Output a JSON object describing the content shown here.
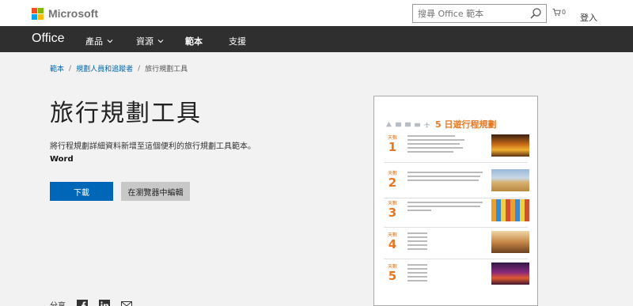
{
  "header": {
    "brand": "Microsoft",
    "search_placeholder": "搜尋 Office 範本",
    "cart_count": "0",
    "signin": "登入"
  },
  "nav": {
    "brand": "Office",
    "items": [
      {
        "label": "產品",
        "has_dropdown": true
      },
      {
        "label": "資源",
        "has_dropdown": true
      },
      {
        "label": "範本",
        "has_dropdown": false,
        "active": true
      },
      {
        "label": "支援",
        "has_dropdown": false
      }
    ]
  },
  "breadcrumb": {
    "items": [
      "範本",
      "規劃人員和追蹤者"
    ],
    "current": "旅行規劃工具"
  },
  "main": {
    "title": "旅行規劃工具",
    "description": "將行程規劃詳細資料新增至這個便利的旅行規劃工具範本。",
    "app": "Word",
    "download_label": "下載",
    "browser_edit_label": "在瀏覽器中編輯",
    "share_label": "分享"
  },
  "preview": {
    "title": "5 日遊行程規劃",
    "day_label": "天數",
    "days": [
      "1",
      "2",
      "3",
      "4",
      "5"
    ]
  },
  "colors": {
    "accent": "#e87722",
    "nav_bg": "#2f2f2f",
    "primary_button": "#0067b8",
    "link": "#0066b3"
  }
}
